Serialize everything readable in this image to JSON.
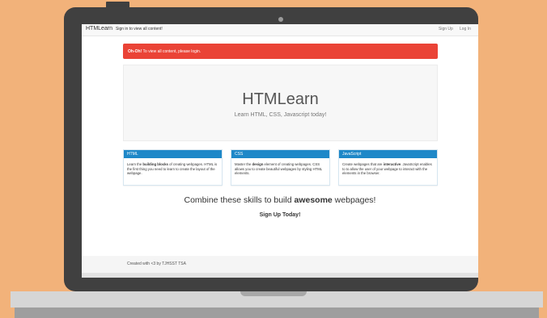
{
  "navbar": {
    "brand": "HTMLearn",
    "message": "Sign in to view all content!",
    "signup": "Sign Up",
    "login": "Log In"
  },
  "alert": {
    "strong": "Oh-Oh!",
    "text": " To view all content, please login."
  },
  "hero": {
    "title": "HTMLearn",
    "subtitle": "Learn HTML, CSS, Javascript today!"
  },
  "cards": [
    {
      "title": "HTML",
      "pre": "Learn the ",
      "strong": "building blocks",
      "post": " of creating webpages. HTML is the first thing you need to learn to create the layout of the webpage."
    },
    {
      "title": "CSS",
      "pre": "Master the ",
      "strong": "design",
      "post": " element of creating webpages. CSS allows you to create beautiful webpages by styling HTML elements."
    },
    {
      "title": "JavaScript",
      "pre": "Create webpages that are ",
      "strong": "interactive",
      "post": ". JavaScript enables to to allow the user of your webpage to interact with the elements in the browser."
    }
  ],
  "tagline": {
    "pre": "Combine these skills to build ",
    "strong": "awesome",
    "post": " webpages!"
  },
  "cta": "Sign Up Today!",
  "footer": "Created with <3 by TJHSST TSA",
  "colors": {
    "background": "#f2b27a",
    "alert": "#ea4336",
    "card_header": "#1e88c8",
    "laptop_bezel": "#404040"
  }
}
